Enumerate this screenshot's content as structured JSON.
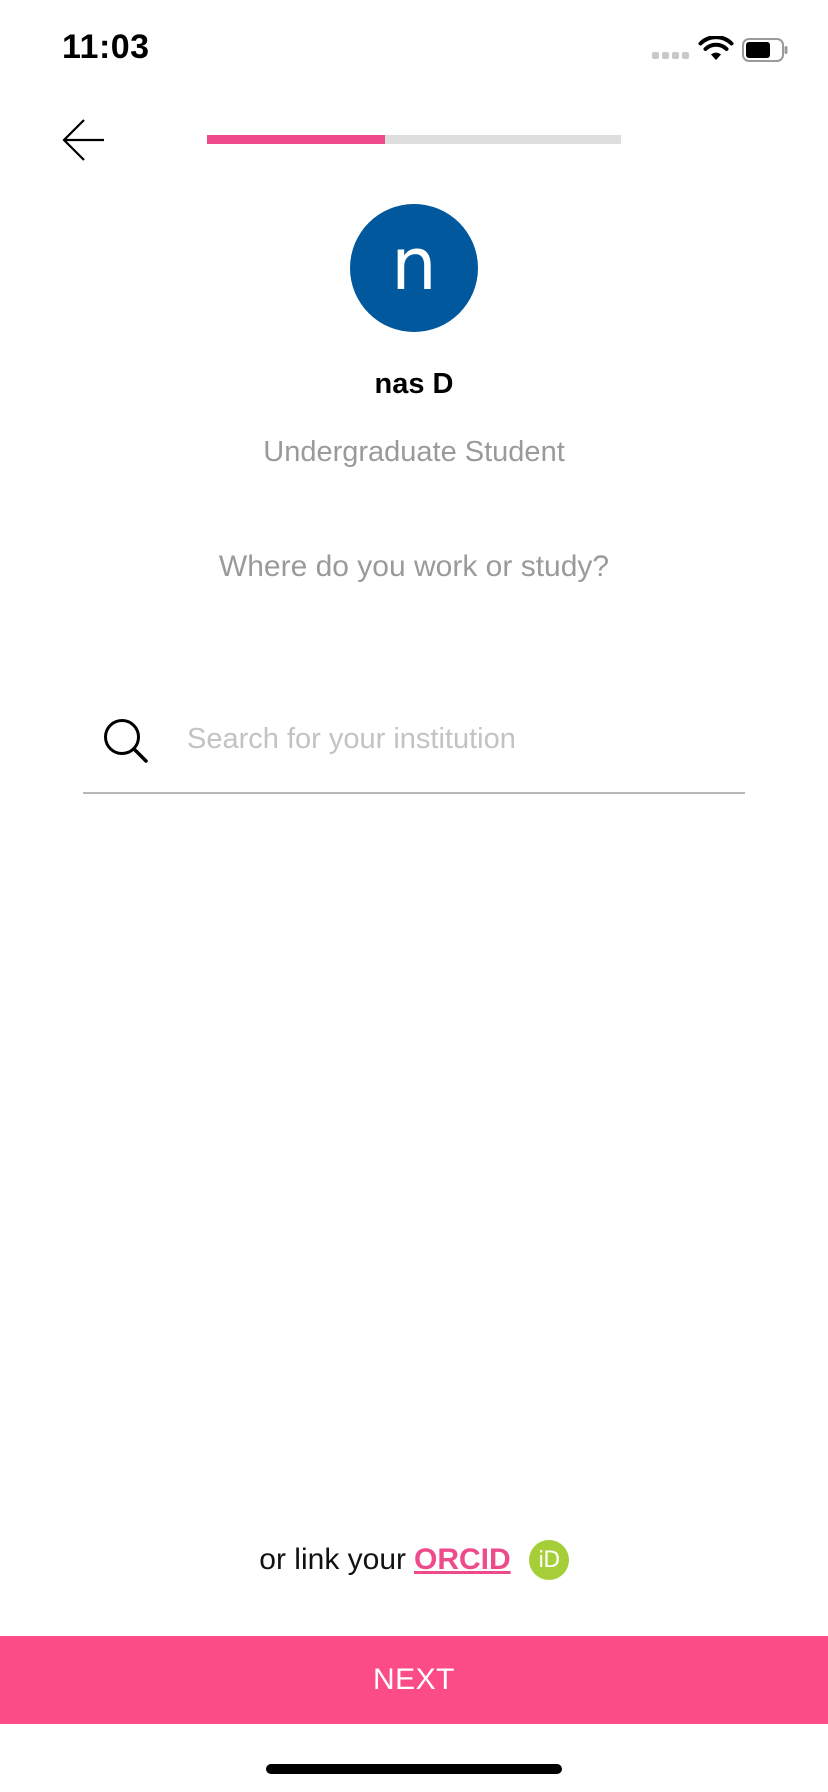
{
  "status_bar": {
    "time": "11:03"
  },
  "progress": {
    "fraction": 0.43,
    "fill_color": "#ee4b8c",
    "track_color": "#dedede"
  },
  "profile": {
    "avatar_letter": "n",
    "avatar_color": "#01589c",
    "name": "nas D",
    "role": "Undergraduate Student"
  },
  "question": "Where do you work or study?",
  "search": {
    "placeholder": "Search for your institution",
    "value": "",
    "icon": "search-icon"
  },
  "orcid": {
    "prefix": "or link your",
    "link_label": "ORCID",
    "icon_label": "iD",
    "icon_color": "#a6ce39",
    "link_color": "#ee4b8c"
  },
  "next_button": {
    "label": "NEXT",
    "color": "#fb4c88"
  },
  "icons": {
    "back": "arrow-left-icon",
    "wifi": "wifi-icon",
    "battery": "battery-icon",
    "signal": "cellular-signal-icon"
  }
}
